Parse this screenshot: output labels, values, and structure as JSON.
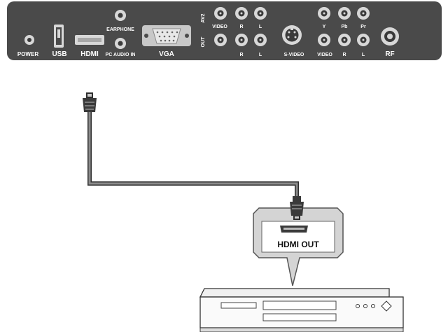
{
  "panel": {
    "power": "POWER",
    "usb": "USB",
    "hdmi": "HDMI",
    "earphone": "EARPHONE",
    "pc_audio_in": "PC AUDIO IN",
    "vga": "VGA",
    "av2": "AV2",
    "out": "OUT",
    "video_top": "VIDEO",
    "r_top": "R",
    "l_top": "L",
    "r_bottom": "R",
    "l_bottom": "L",
    "s_video": "S-VIDEO",
    "y": "Y",
    "pb": "Pb",
    "pr": "Pr",
    "video_bottom": "VIDEO",
    "r_comp": "R",
    "l_comp": "L",
    "rf": "RF"
  },
  "callout": {
    "hdmi_out": "HDMI OUT"
  },
  "colors": {
    "panel": "#4a4a4a",
    "jack_ring": "#d8d8d8",
    "cable": "#5a5a5a",
    "callout_fill": "#d4d4d4",
    "device_outline": "#333333"
  }
}
